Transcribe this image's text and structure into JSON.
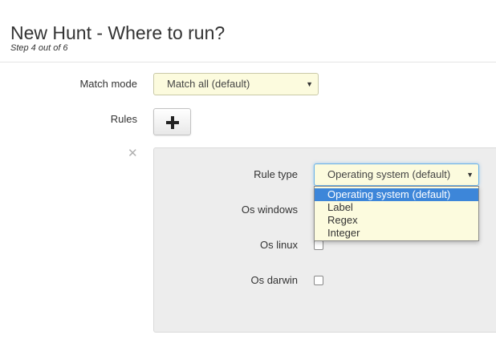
{
  "header": {
    "title": "New Hunt - Where to run?",
    "subtitle": "Step 4 out of 6"
  },
  "form": {
    "match_mode_label": "Match mode",
    "match_mode_value": "Match all (default)",
    "rules_label": "Rules",
    "add_rule_icon": "plus-icon",
    "remove_rule_icon": "times-icon"
  },
  "rule": {
    "rule_type_label": "Rule type",
    "rule_type_value": "Operating system (default)",
    "rule_type_options": [
      "Operating system (default)",
      "Label",
      "Regex",
      "Integer"
    ],
    "selected_option_index": 0,
    "os_windows_label": "Os windows",
    "os_linux_label": "Os linux",
    "os_darwin_label": "Os darwin",
    "os_windows_checked": false,
    "os_linux_checked": false,
    "os_darwin_checked": false
  },
  "colors": {
    "select_bg": "#fcfbde",
    "highlight": "#3d86d9",
    "focus_border": "#66afe9",
    "panel_bg": "#ededed"
  }
}
